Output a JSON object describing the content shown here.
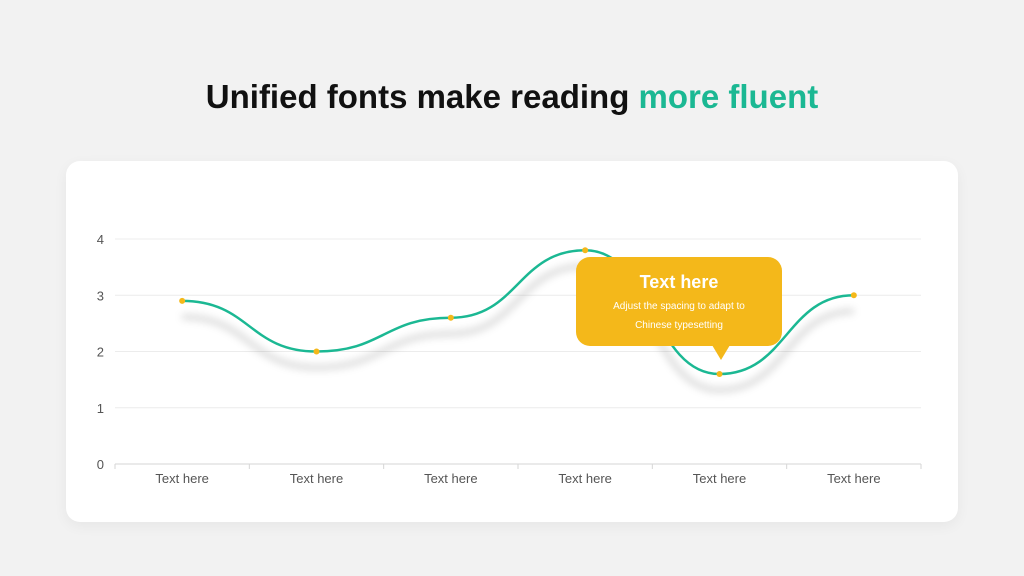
{
  "title": {
    "main": "Unified fonts make reading ",
    "accent": "more fluent"
  },
  "colors": {
    "accent": "#1bb893",
    "highlight": "#f4b81a",
    "background": "#f2f2f2",
    "card": "#ffffff"
  },
  "callout": {
    "title": "Text here",
    "body": "Adjust the spacing to adapt to Chinese typesetting"
  },
  "chart_data": {
    "type": "line",
    "title": "",
    "xlabel": "",
    "ylabel": "",
    "categories": [
      "Text here",
      "Text here",
      "Text here",
      "Text here",
      "Text here",
      "Text here"
    ],
    "series": [
      {
        "values": [
          2.9,
          2.0,
          2.6,
          3.8,
          1.6,
          3.0
        ]
      }
    ],
    "ylim": [
      0,
      4
    ],
    "yticks": [
      0,
      1,
      2,
      3,
      4
    ],
    "grid": true,
    "smooth": true,
    "line_color": "#1bb893",
    "point_color": "#f4b81a"
  }
}
